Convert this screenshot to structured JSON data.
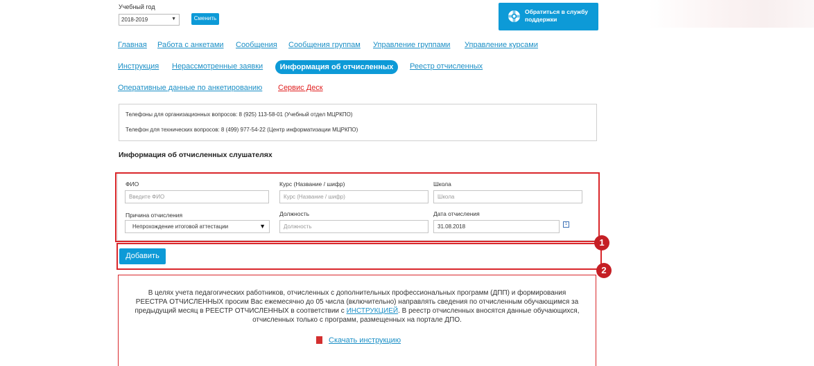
{
  "year": {
    "label": "Учебный год",
    "value": "2018-2019",
    "change_button": "Сменить"
  },
  "support": {
    "label": "Обратиться в службу поддержки",
    "icon": "lifebuoy-icon"
  },
  "nav": {
    "row1": [
      "Главная",
      "Работа с анкетами",
      "Сообщения",
      "Сообщения группам",
      "Управление группами",
      "Управление курсами"
    ],
    "row2": [
      "Инструкция",
      "Нерассмотренные заявки",
      "Информация об отчисленных",
      "Реестр отчисленных"
    ],
    "row3": [
      "Оперативные данные по анкетированию",
      "Сервис Деск"
    ]
  },
  "phones": {
    "line1": "Телефоны для организационных вопросов: 8 (925) 113-58-01 (Учебный отдел МЦРКПО)",
    "line2": "Телефон для технических вопросов: 8 (499) 977-54-22 (Центр информатизации МЦРКПО)"
  },
  "section_title": "Информация об отчисленных слушателях",
  "form": {
    "fio_label": "ФИО",
    "fio_placeholder": "Введите ФИО",
    "course_label": "Курс (Название / шифр)",
    "course_placeholder": "Курс (Название / шифр)",
    "school_label": "Школа",
    "school_placeholder": "Школа",
    "reason_label": "Причина отчисления",
    "reason_value": "Непрохождение итоговой аттестации",
    "position_label": "Должность",
    "position_placeholder": "Должность",
    "date_label": "Дата отчисления",
    "date_value": "31.08.2018",
    "calendar_icon": "calendar-icon"
  },
  "add_button": "Добавить",
  "badges": {
    "one": "1",
    "two": "2"
  },
  "info": {
    "text_part1": "В целях учета педагогических работников, отчисленных с дополнительных профессиональных программ (ДПП) и формирования РЕЕСТРА ОТЧИСЛЕННЫХ просим Вас ежемесячно до 05 числа (включительно) направлять сведения по отчисленным обучающимся за предыдущий месяц в РЕЕСТР ОТЧИСЛЕННЫХ в соответствии с",
    "link_text": "ИНСТРУКЦИЕЙ",
    "text_part2": ". В реестр отчисленных вносятся данные обучающихся, отчисленных только с программ, размещенных на портале ДПО.",
    "download_text": "Скачать инструкцию",
    "download_icon": "pdf-icon"
  },
  "colors": {
    "accent": "#0d9ad7",
    "link": "#1b8fc6",
    "highlight": "#d9262a",
    "badge": "#c51f25"
  }
}
